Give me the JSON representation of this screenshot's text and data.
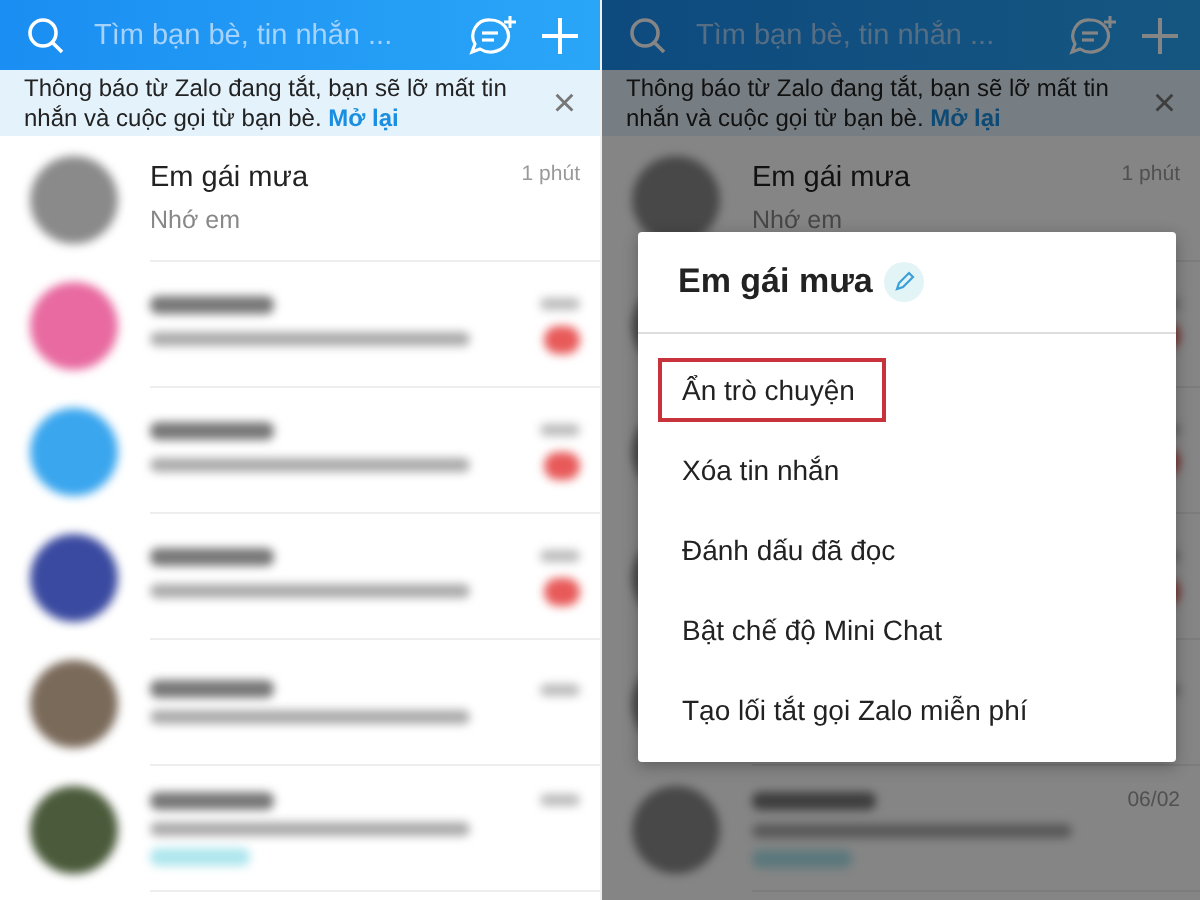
{
  "screens": [
    {
      "search": {
        "placeholder": "Tìm bạn bè, tin nhắn ..."
      },
      "notice": {
        "text": "Thông báo từ Zalo đang tắt, bạn sẽ lỡ mất tin nhắn và cuộc gọi từ bạn bè.",
        "link": "Mở lại",
        "close": "×"
      },
      "chats": [
        {
          "kind": "contact",
          "name": "Em gái mưa",
          "preview": "Nhớ em",
          "time": "1 phút"
        },
        {
          "kind": "blurred",
          "color": "#e86aa0",
          "unread": true,
          "tag": false
        },
        {
          "kind": "blurred",
          "color": "#3aa6ee",
          "unread": true,
          "tag": false
        },
        {
          "kind": "blurred",
          "color": "#3a4aa0",
          "unread": true,
          "tag": false
        },
        {
          "kind": "blurred",
          "color": "#7a6a5a",
          "unread": false,
          "tag": false
        },
        {
          "kind": "blurred",
          "color": "#4a5a3a",
          "unread": false,
          "tag": true
        }
      ]
    },
    {
      "search": {
        "placeholder": "Tìm bạn bè, tin nhắn ..."
      },
      "notice": {
        "text": "Thông báo từ Zalo đang tắt, bạn sẽ lỡ mất tin nhắn và cuộc gọi từ bạn bè.",
        "link": "Mở lại",
        "close": "×"
      },
      "chats": [
        {
          "kind": "contact",
          "name": "Em gái mưa",
          "preview": "Nhớ em",
          "time": "1 phút"
        },
        {
          "kind": "blurred",
          "unread": true,
          "tag": false,
          "text_visible": false
        },
        {
          "kind": "blurred",
          "unread": true,
          "tag": false,
          "text_visible": false
        },
        {
          "kind": "blurred",
          "unread": true,
          "tag": false
        },
        {
          "kind": "blurred",
          "unread": false,
          "tag": false
        },
        {
          "kind": "blurred",
          "unread": false,
          "tag": true,
          "time": "06/02"
        }
      ],
      "dialog": {
        "title": "Em gái mưa",
        "items": [
          {
            "label": "Ẩn trò chuyện",
            "highlighted": true
          },
          {
            "label": "Xóa tin nhắn",
            "highlighted": false
          },
          {
            "label": "Đánh dấu đã đọc",
            "highlighted": false
          },
          {
            "label": "Bật chế độ Mini Chat",
            "highlighted": false
          },
          {
            "label": "Tạo lối tắt gọi Zalo miễn phí",
            "highlighted": false
          }
        ]
      }
    }
  ]
}
